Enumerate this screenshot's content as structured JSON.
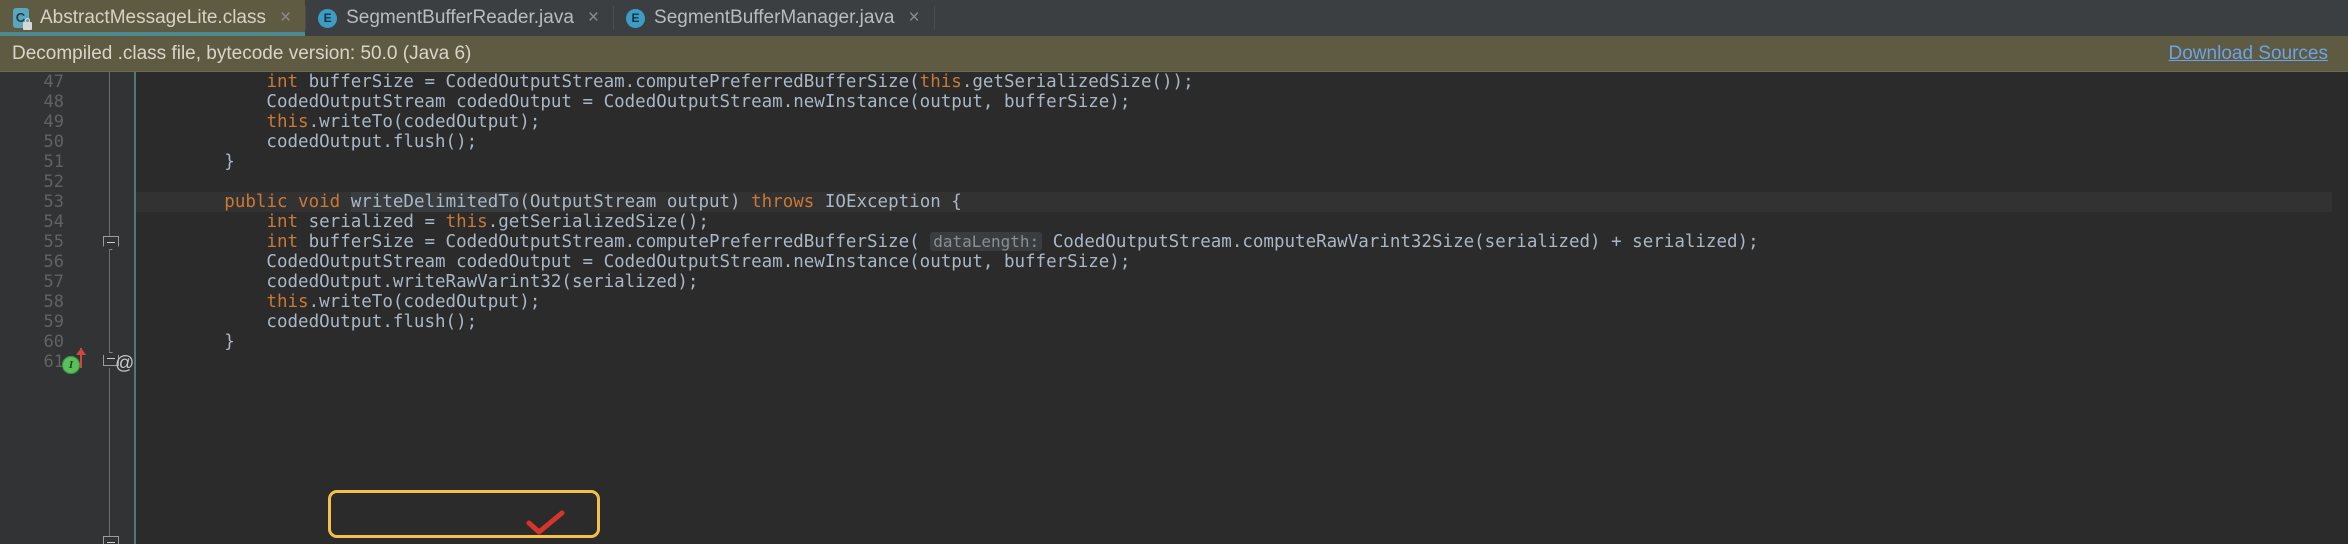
{
  "tabs": [
    {
      "label": "AbstractMessageLite.class",
      "icon": "class-file-icon",
      "active": true,
      "close": "×"
    },
    {
      "label": "SegmentBufferReader.java",
      "icon": "java-enum-icon",
      "active": false,
      "close": "×"
    },
    {
      "label": "SegmentBufferManager.java",
      "icon": "java-enum-icon",
      "active": false,
      "close": "×"
    }
  ],
  "banner": {
    "message": "Decompiled .class file, bytecode version: 50.0 (Java 6)",
    "link": "Download Sources",
    "background": "#5f5b43",
    "link_color": "#6aa3e8"
  },
  "gutter": {
    "line_numbers": [
      "47",
      "48",
      "49",
      "50",
      "51",
      "52",
      "53",
      "54",
      "55",
      "56",
      "57",
      "58",
      "59",
      "60",
      "61"
    ],
    "markers": {
      "implementation_line": "53",
      "implementation_glyph": "I",
      "annotation_glyph": "@"
    }
  },
  "editor": {
    "current_line": "53",
    "accent_color": "#cc7832",
    "text_color": "#a9b7c6",
    "background": "#2b2b2b",
    "lines": [
      {
        "num": "47",
        "tokens": [
          {
            "t": "            ",
            "c": "id"
          },
          {
            "t": "int",
            "c": "kw"
          },
          {
            "t": " bufferSize = CodedOutputStream.computePreferredBufferSize(",
            "c": "id"
          },
          {
            "t": "this",
            "c": "kw"
          },
          {
            "t": ".getSerializedSize());",
            "c": "id"
          }
        ]
      },
      {
        "num": "48",
        "tokens": [
          {
            "t": "            CodedOutputStream codedOutput = CodedOutputStream.newInstance(output, bufferSize);",
            "c": "id"
          }
        ]
      },
      {
        "num": "49",
        "tokens": [
          {
            "t": "            ",
            "c": "id"
          },
          {
            "t": "this",
            "c": "kw"
          },
          {
            "t": ".writeTo(codedOutput);",
            "c": "id"
          }
        ]
      },
      {
        "num": "50",
        "tokens": [
          {
            "t": "            codedOutput.flush();",
            "c": "id"
          }
        ]
      },
      {
        "num": "51",
        "tokens": [
          {
            "t": "        }",
            "c": "id"
          }
        ]
      },
      {
        "num": "52",
        "tokens": [
          {
            "t": "",
            "c": "id"
          }
        ]
      },
      {
        "num": "53",
        "tokens": [
          {
            "t": "        ",
            "c": "id"
          },
          {
            "t": "public void",
            "c": "kw"
          },
          {
            "t": " ",
            "c": "id"
          },
          {
            "t": "writeDelimitedTo",
            "c": "sel"
          },
          {
            "t": "(OutputStream output) ",
            "c": "id"
          },
          {
            "t": "throws",
            "c": "kw"
          },
          {
            "t": " IOException {",
            "c": "id"
          }
        ]
      },
      {
        "num": "54",
        "tokens": [
          {
            "t": "            ",
            "c": "id"
          },
          {
            "t": "int",
            "c": "kw"
          },
          {
            "t": " serialized = ",
            "c": "id"
          },
          {
            "t": "this",
            "c": "kw"
          },
          {
            "t": ".getSerializedSize();",
            "c": "id"
          }
        ]
      },
      {
        "num": "55",
        "tokens": [
          {
            "t": "            ",
            "c": "id"
          },
          {
            "t": "int",
            "c": "kw"
          },
          {
            "t": " bufferSize = CodedOutputStream.computePreferredBufferSize( ",
            "c": "id"
          },
          {
            "t": "dataLength:",
            "c": "hint"
          },
          {
            "t": " CodedOutputStream.computeRawVarint32Size(serialized) + serialized);",
            "c": "id"
          }
        ]
      },
      {
        "num": "56",
        "tokens": [
          {
            "t": "            CodedOutputStream codedOutput = CodedOutputStream.newInstance(output, bufferSize);",
            "c": "id"
          }
        ]
      },
      {
        "num": "57",
        "tokens": [
          {
            "t": "            codedOutput.writeRawVarint32(serialized);",
            "c": "id"
          }
        ]
      },
      {
        "num": "58",
        "tokens": [
          {
            "t": "            ",
            "c": "id"
          },
          {
            "t": "this",
            "c": "kw"
          },
          {
            "t": ".writeTo(codedOutput);",
            "c": "id"
          }
        ]
      },
      {
        "num": "59",
        "tokens": [
          {
            "t": "            codedOutput.flush();",
            "c": "id"
          }
        ]
      },
      {
        "num": "60",
        "tokens": [
          {
            "t": "        }",
            "c": "id"
          }
        ]
      },
      {
        "num": "61",
        "tokens": [
          {
            "t": "",
            "c": "id"
          }
        ]
      }
    ]
  },
  "annotation": {
    "highlight_box": {
      "lines": [
        "58",
        "59"
      ],
      "color": "#f3c14b"
    },
    "checkmark": {
      "color": "#d6352b",
      "after_line": "59"
    }
  }
}
